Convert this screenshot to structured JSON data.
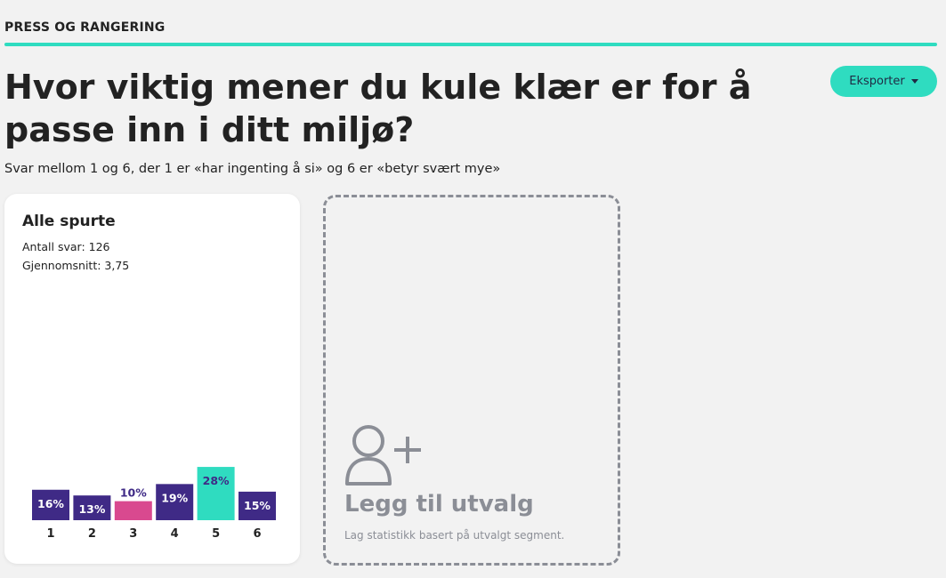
{
  "section": {
    "label": "PRESS OG RANGERING"
  },
  "question": {
    "title": "Hvor viktig mener du kule klær er for å passe inn i ditt miljø?"
  },
  "subtitle": "Svar mellom 1 og 6, der 1 er «har ingenting å si» og 6 er «betyr svært mye»",
  "export": {
    "label": "Eksporter"
  },
  "card": {
    "title": "Alle spurte",
    "count_text": "Antall svar: 126",
    "average_text": "Gjennomsnitt: 3,75"
  },
  "add_segment": {
    "title": "Legg til utvalg",
    "description": "Lag statistikk basert på utvalgt segment."
  },
  "colors": {
    "accent": "#2fdcc0",
    "bar_default": "#3f2a86",
    "bar_average": "#d9498f",
    "bar_max": "#2fdcc0",
    "muted": "#8b8e96"
  },
  "chart_data": {
    "type": "bar",
    "categories": [
      "1",
      "2",
      "3",
      "4",
      "5",
      "6"
    ],
    "values": [
      16,
      13,
      10,
      19,
      28,
      15
    ],
    "value_labels": [
      "16%",
      "13%",
      "10%",
      "19%",
      "28%",
      "15%"
    ],
    "highlight": {
      "average_category": "3",
      "max_category": "5"
    },
    "title": "",
    "xlabel": "",
    "ylabel": "",
    "grid": false
  }
}
